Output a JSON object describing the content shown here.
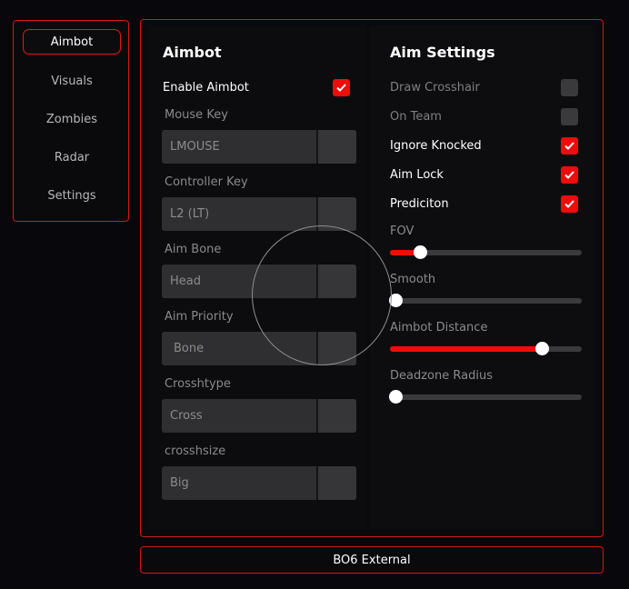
{
  "sidebar": {
    "items": [
      {
        "label": "Aimbot",
        "active": true
      },
      {
        "label": "Visuals",
        "active": false
      },
      {
        "label": "Zombies",
        "active": false
      },
      {
        "label": "Radar",
        "active": false
      },
      {
        "label": "Settings",
        "active": false
      }
    ]
  },
  "aimbot": {
    "title": "Aimbot",
    "enable": {
      "label": "Enable Aimbot",
      "checked": true
    },
    "mouse_key": {
      "label": "Mouse Key",
      "value": "LMOUSE"
    },
    "controller_key": {
      "label": "Controller Key",
      "value": "L2 (LT)"
    },
    "aim_bone": {
      "label": "Aim Bone",
      "value": "Head"
    },
    "aim_priority": {
      "label": "Aim Priority",
      "value": "Bone"
    },
    "crosshtype": {
      "label": "Crosshtype",
      "value": "Cross"
    },
    "crosshsize": {
      "label": "crosshsize",
      "value": "Big"
    }
  },
  "aim_settings": {
    "title": "Aim Settings",
    "draw_crosshair": {
      "label": "Draw Crosshair",
      "checked": false
    },
    "on_team": {
      "label": "On Team",
      "checked": false
    },
    "ignore_knocked": {
      "label": "Ignore Knocked",
      "checked": true
    },
    "aim_lock": {
      "label": "Aim Lock",
      "checked": true
    },
    "prediction": {
      "label": "Prediciton",
      "checked": true
    },
    "sliders": {
      "fov": {
        "label": "FOV",
        "fraction": 0.14
      },
      "smooth": {
        "label": "Smooth",
        "fraction": 0.0
      },
      "aimbot_distance": {
        "label": "Aimbot Distance",
        "fraction": 0.81
      },
      "deadzone_radius": {
        "label": "Deadzone Radius",
        "fraction": 0.0
      }
    }
  },
  "footer": {
    "label": "BO6 External"
  },
  "colors": {
    "accent": "#ee0c0c",
    "border": "#d21717",
    "background": "#07070c"
  }
}
